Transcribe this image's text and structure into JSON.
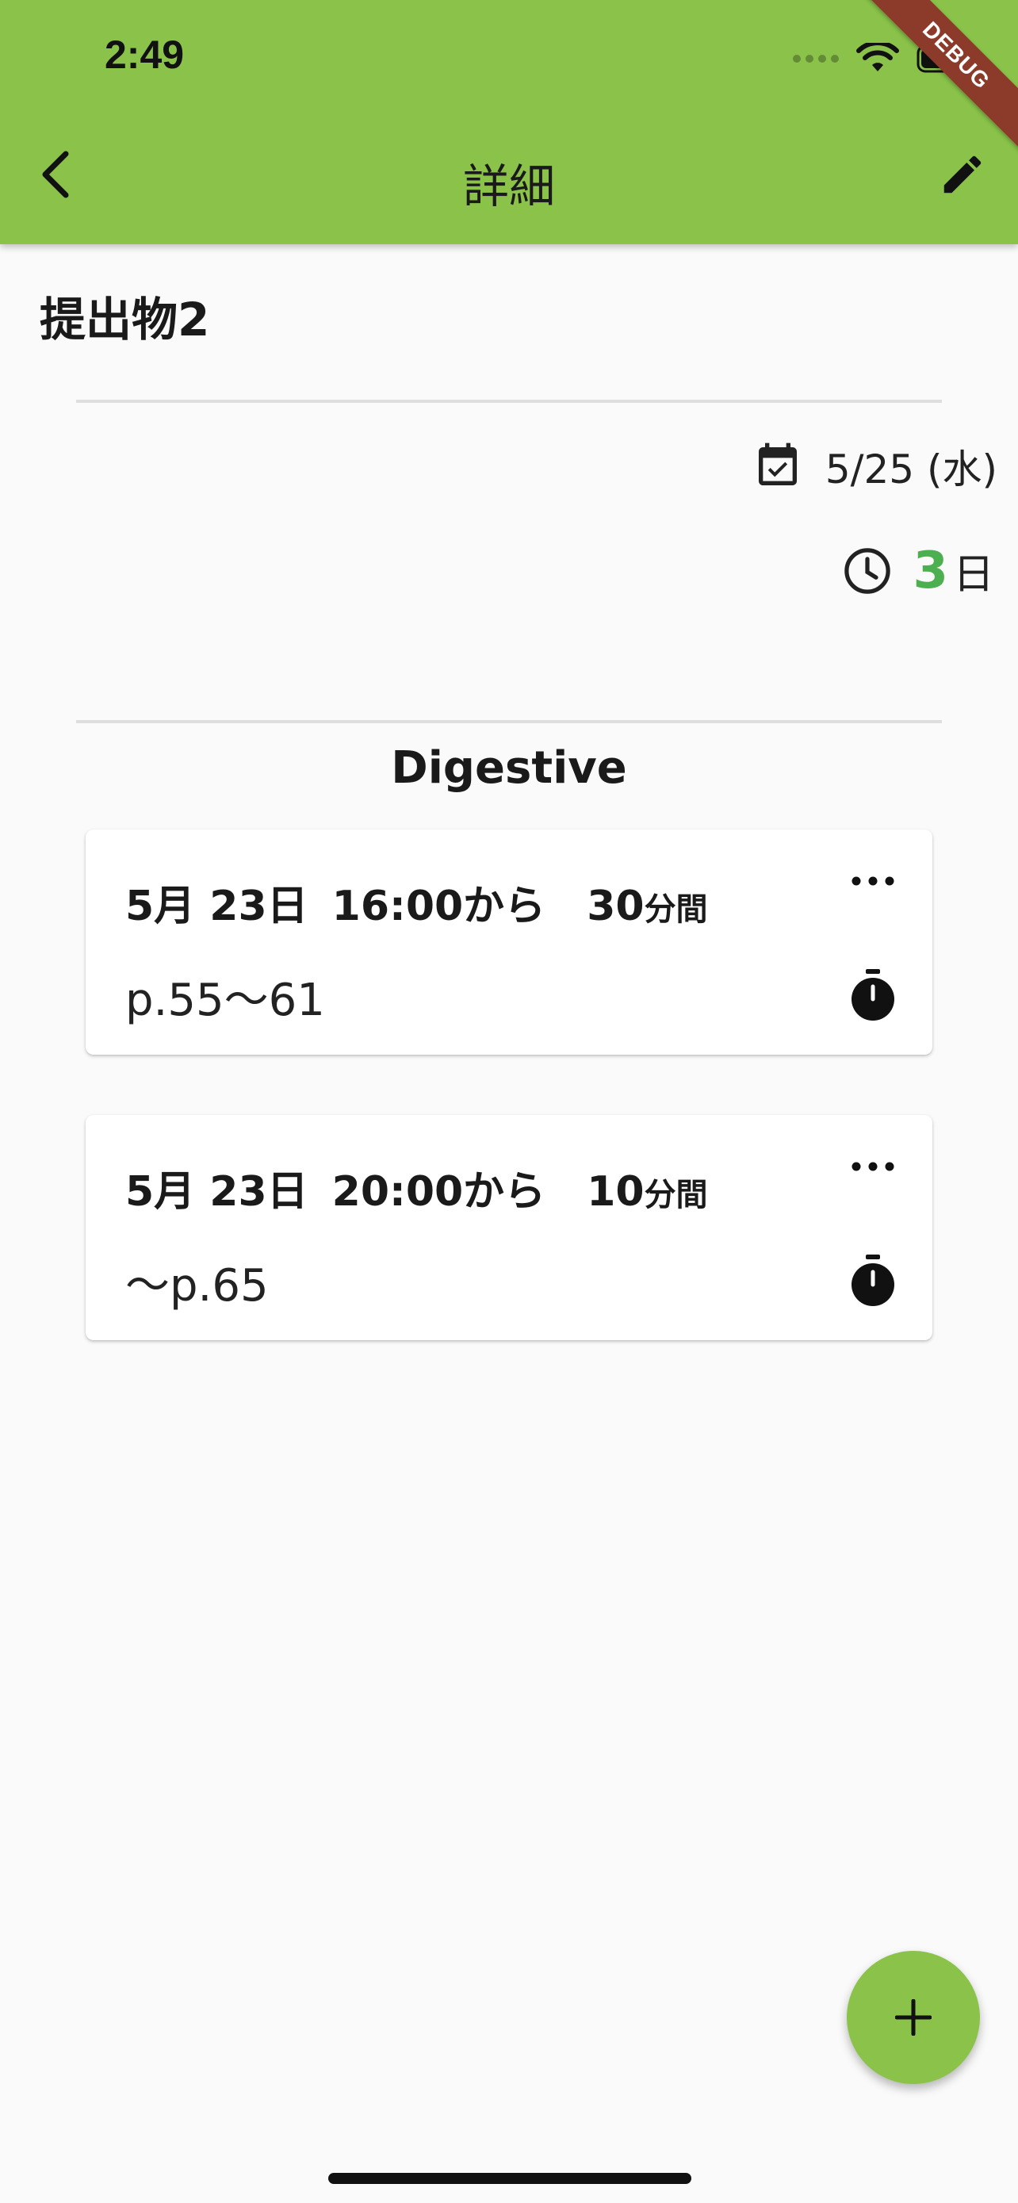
{
  "status_bar": {
    "time": "2:49"
  },
  "debug_banner": "DEBUG",
  "app_bar": {
    "title": "詳細"
  },
  "task": {
    "title": "提出物2",
    "due_date": "5/25 (水)",
    "remaining_value": "3",
    "remaining_unit": "日"
  },
  "subject": "Digestive",
  "sessions": [
    {
      "date": "5月 23日",
      "start": "16:00から",
      "duration_num": "30",
      "duration_unit": "分間",
      "memo": "p.55〜61"
    },
    {
      "date": "5月 23日",
      "start": "20:00から",
      "duration_num": "10",
      "duration_unit": "分間",
      "memo": "〜p.65"
    }
  ],
  "colors": {
    "appbar": "#8bc34a",
    "accent_green": "#4caf50",
    "debug_banner": "#8c3a29",
    "background": "#fafafa"
  },
  "icons": {
    "back": "chevron-left-icon",
    "edit": "pencil-icon",
    "due": "calendar-check-icon",
    "remaining": "clock-icon",
    "more": "more-horiz-icon",
    "timer": "stopwatch-icon",
    "add": "plus-icon"
  }
}
